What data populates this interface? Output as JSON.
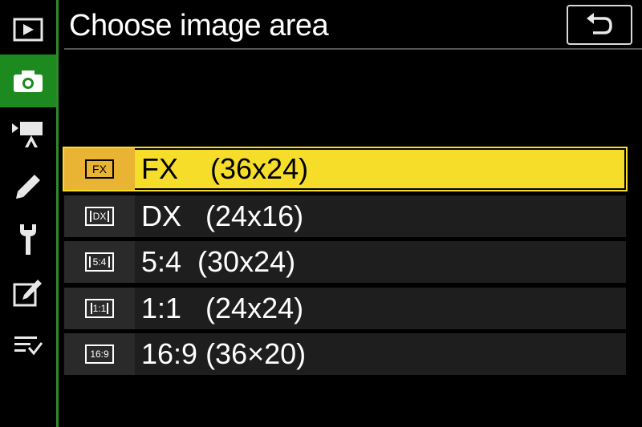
{
  "header": {
    "title": "Choose image area",
    "back_icon": "return-arrow-icon"
  },
  "sidebar": {
    "items": [
      {
        "name": "playback-menu",
        "icon": "playback-icon"
      },
      {
        "name": "photo-shooting-menu",
        "icon": "camera-icon",
        "active": true
      },
      {
        "name": "movie-shooting-menu",
        "icon": "movie-camera-icon"
      },
      {
        "name": "custom-settings-menu",
        "icon": "pencil-icon"
      },
      {
        "name": "setup-menu",
        "icon": "wrench-icon"
      },
      {
        "name": "retouch-menu",
        "icon": "retouch-icon"
      },
      {
        "name": "my-menu",
        "icon": "my-menu-icon"
      }
    ],
    "accent_color": "#1c8a1e"
  },
  "options": [
    {
      "badge": "FX",
      "label": "FX    (36x24)",
      "selected": true
    },
    {
      "badge": "DX",
      "label": "DX   (24x16)",
      "selected": false
    },
    {
      "badge": "5:4",
      "label": "5:4  (30x24)",
      "selected": false
    },
    {
      "badge": "1:1",
      "label": "1:1   (24x24)",
      "selected": false
    },
    {
      "badge": "16:9",
      "label": "16:9 (36×20)",
      "selected": false
    }
  ],
  "colors": {
    "highlight": "#f5dd2a",
    "highlight_badge": "#e9b434"
  }
}
